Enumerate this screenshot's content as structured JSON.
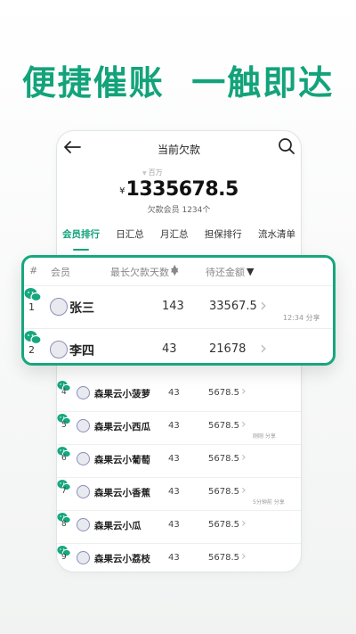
{
  "headline": "便捷催账  一触即达",
  "app": {
    "title": "当前欠款",
    "unit": "百万",
    "currency": "¥",
    "total_amount": "1335678.5",
    "member_count": "欠款会员 1234个",
    "tabs": [
      "会员排行",
      "日汇总",
      "月汇总",
      "担保排行",
      "流水清单"
    ]
  },
  "table_header": {
    "idx": "#",
    "member": "会员",
    "days": "最长欠款天数",
    "amount": "待还金额"
  },
  "highlight_rows": [
    {
      "idx": "1",
      "name": "张三",
      "days": "143",
      "amount": "33567.5",
      "note": "12:34 分享"
    },
    {
      "idx": "2",
      "name": "李四",
      "days": "43",
      "amount": "21678",
      "note": ""
    }
  ],
  "rows": [
    {
      "idx": "4",
      "name": "森果云小菠萝",
      "days": "43",
      "amount": "5678.5",
      "note": ""
    },
    {
      "idx": "5",
      "name": "森果云小西瓜",
      "days": "43",
      "amount": "5678.5",
      "note": "刚刚 分享"
    },
    {
      "idx": "6",
      "name": "森果云小葡萄",
      "days": "43",
      "amount": "5678.5",
      "note": ""
    },
    {
      "idx": "7",
      "name": "森果云小香蕉",
      "days": "43",
      "amount": "5678.5",
      "note": "5分钟前 分享"
    },
    {
      "idx": "8",
      "name": "森果云小瓜",
      "days": "43",
      "amount": "5678.5",
      "note": ""
    },
    {
      "idx": "9",
      "name": "森果云小荔枝",
      "days": "43",
      "amount": "5678.5",
      "note": ""
    }
  ],
  "icons": {
    "back": "back-arrow-icon",
    "search": "search-icon",
    "share": "wechat-icon",
    "chevron": "chevron-right-icon"
  },
  "colors": {
    "accent": "#13a37a",
    "wechat": "#16a77e"
  }
}
